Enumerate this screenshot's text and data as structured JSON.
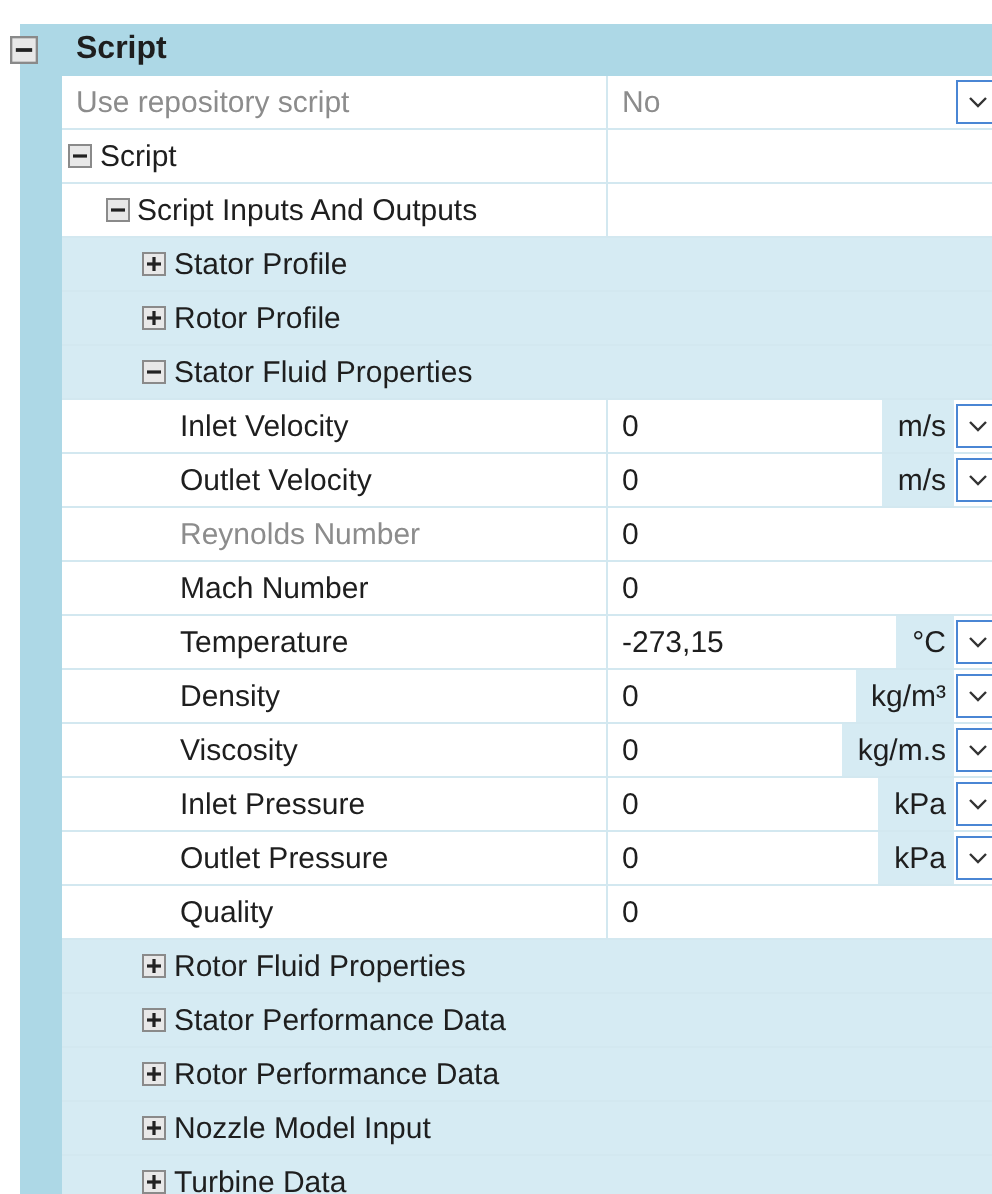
{
  "section": {
    "title": "Script",
    "expanded": true,
    "items": [
      {
        "kind": "property",
        "label": "Use repository script",
        "value": "No",
        "disabled": true,
        "dropdown": true
      },
      {
        "kind": "group",
        "label": "Script",
        "expanded": true,
        "children": [
          {
            "kind": "group",
            "label": "Script Inputs And Outputs",
            "expanded": true,
            "children": [
              {
                "kind": "group",
                "label": "Stator Profile",
                "expanded": false
              },
              {
                "kind": "group",
                "label": "Rotor Profile",
                "expanded": false
              },
              {
                "kind": "group",
                "label": "Stator Fluid Properties",
                "expanded": true,
                "children": [
                  {
                    "kind": "property",
                    "label": "Inlet Velocity",
                    "value": "0",
                    "unit": "m/s",
                    "disabled": false,
                    "dropdown": true
                  },
                  {
                    "kind": "property",
                    "label": "Outlet Velocity",
                    "value": "0",
                    "unit": "m/s",
                    "disabled": false,
                    "dropdown": true
                  },
                  {
                    "kind": "property",
                    "label": "Reynolds Number",
                    "value": "0",
                    "disabled": true,
                    "dropdown": false
                  },
                  {
                    "kind": "property",
                    "label": "Mach Number",
                    "value": "0",
                    "disabled": false,
                    "dropdown": false
                  },
                  {
                    "kind": "property",
                    "label": "Temperature",
                    "value": "-273,15",
                    "unit": "°C",
                    "disabled": false,
                    "dropdown": true
                  },
                  {
                    "kind": "property",
                    "label": "Density",
                    "value": "0",
                    "unit": "kg/m³",
                    "disabled": false,
                    "dropdown": true
                  },
                  {
                    "kind": "property",
                    "label": "Viscosity",
                    "value": "0",
                    "unit": "kg/m.s",
                    "disabled": false,
                    "dropdown": true
                  },
                  {
                    "kind": "property",
                    "label": "Inlet Pressure",
                    "value": "0",
                    "unit": "kPa",
                    "disabled": false,
                    "dropdown": true
                  },
                  {
                    "kind": "property",
                    "label": "Outlet Pressure",
                    "value": "0",
                    "unit": "kPa",
                    "disabled": false,
                    "dropdown": true
                  },
                  {
                    "kind": "property",
                    "label": "Quality",
                    "value": "0",
                    "disabled": false,
                    "dropdown": false
                  }
                ]
              },
              {
                "kind": "group",
                "label": "Rotor Fluid Properties",
                "expanded": false
              },
              {
                "kind": "group",
                "label": "Stator Performance Data",
                "expanded": false
              },
              {
                "kind": "group",
                "label": "Rotor Performance Data",
                "expanded": false
              },
              {
                "kind": "group",
                "label": "Nozzle Model Input",
                "expanded": false
              },
              {
                "kind": "group",
                "label": "Turbine Data",
                "expanded": false
              }
            ]
          }
        ]
      }
    ]
  }
}
